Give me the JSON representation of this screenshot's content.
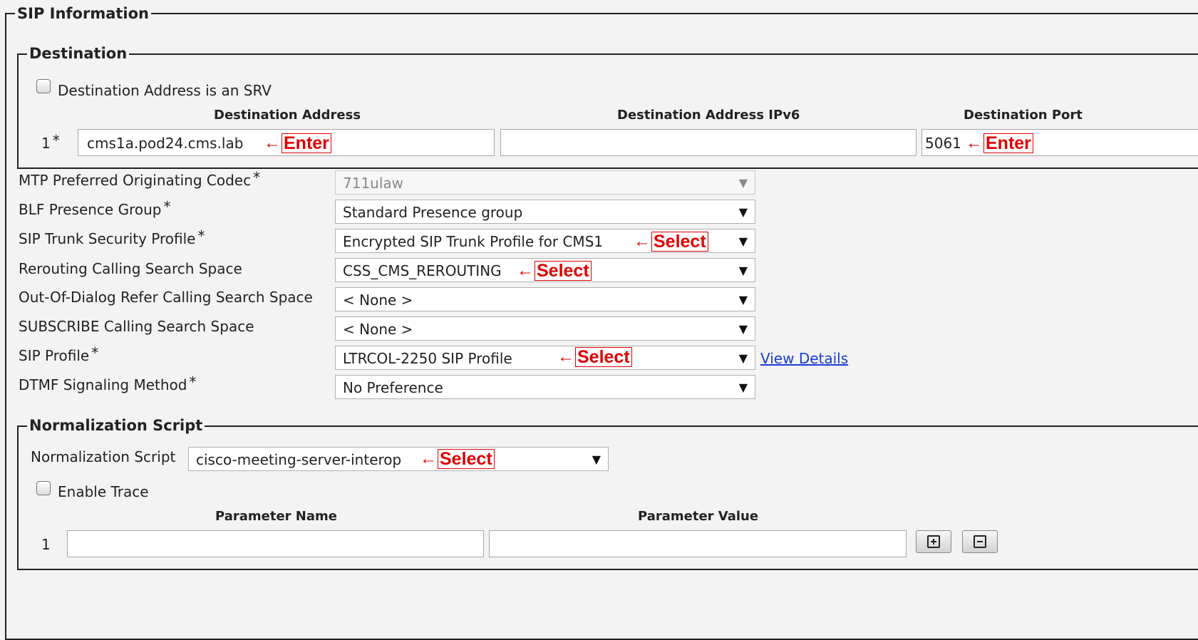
{
  "sip_information": {
    "legend": "SIP Information"
  },
  "destination": {
    "legend": "Destination",
    "srv_checkbox_label": "Destination Address is an SRV",
    "col_address": "Destination Address",
    "col_ipv6": "Destination Address IPv6",
    "col_port": "Destination Port",
    "row_number": "1",
    "required_mark": "*",
    "address_value": "cms1a.pod24.cms.lab",
    "ipv6_value": "",
    "port_value": "5061"
  },
  "fields": [
    {
      "label": "MTP Preferred Originating Codec",
      "required": "*",
      "value": "711ulaw",
      "disabled": true
    },
    {
      "label": "BLF Presence Group",
      "required": "*",
      "value": "Standard Presence group"
    },
    {
      "label": "SIP Trunk Security Profile",
      "required": "*",
      "value": "Encrypted SIP Trunk Profile for CMS1"
    },
    {
      "label": "Rerouting Calling Search Space",
      "value": "CSS_CMS_REROUTING"
    },
    {
      "label": "Out-Of-Dialog Refer Calling Search Space",
      "value": "< None >"
    },
    {
      "label": "SUBSCRIBE Calling Search Space",
      "value": "< None >"
    },
    {
      "label": "SIP Profile",
      "required": "*",
      "value": "LTRCOL-2250 SIP Profile"
    },
    {
      "label": "DTMF Signaling Method",
      "required": "*",
      "value": "No Preference"
    }
  ],
  "view_details_link": "View Details",
  "dropdown_arrow": "▼",
  "normalization": {
    "legend": "Normalization Script",
    "script_label": "Normalization Script",
    "script_value": "cisco-meeting-server-interop",
    "enable_trace_label": "Enable Trace",
    "col_param_name": "Parameter Name",
    "col_param_value": "Parameter Value",
    "row_number": "1",
    "param_name_value": "",
    "param_value_value": ""
  },
  "annotations": {
    "arrow": "←",
    "enter": "Enter",
    "select": "Select",
    "color": "#e00000"
  },
  "icons": {
    "add": "plus-square-icon",
    "remove": "minus-square-icon"
  }
}
